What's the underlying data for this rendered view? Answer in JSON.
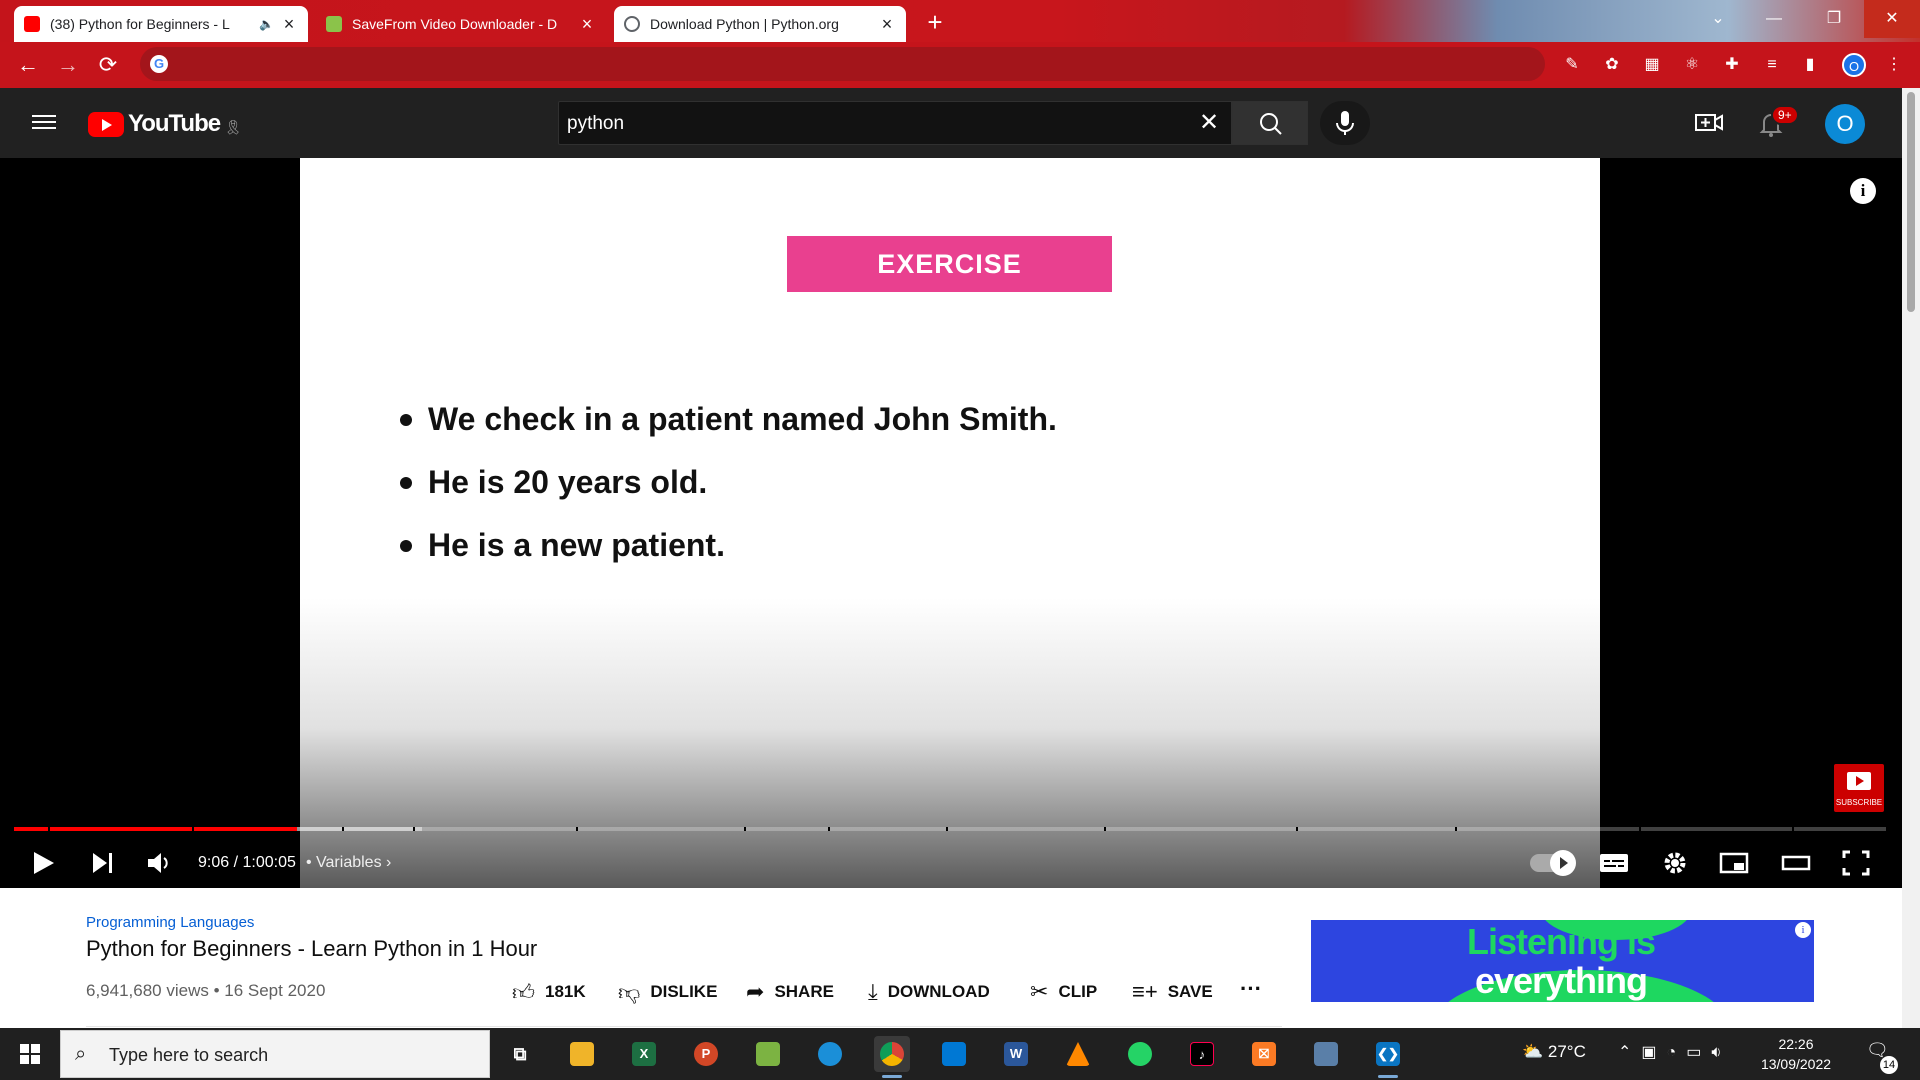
{
  "browser": {
    "tabs": [
      {
        "title": "(38) Python for Beginners - L",
        "active": true
      },
      {
        "title": "SaveFrom Video Downloader - D",
        "active": false
      },
      {
        "title": "Download Python | Python.org",
        "active": false
      }
    ],
    "new_tab": "+",
    "window_controls": {
      "more": "⌄",
      "minimize": "—",
      "restore": "❐",
      "close": "✕"
    },
    "nav": {
      "back": "←",
      "forward": "→",
      "reload": "⟳"
    },
    "omnibox_icon": "G",
    "profile_initial": "O"
  },
  "youtube": {
    "logo_text": "YouTube",
    "search": {
      "value": "python",
      "clear": "✕"
    },
    "notifications_badge": "9+",
    "avatar_initial": "O"
  },
  "player": {
    "slide": {
      "banner": "EXERCISE",
      "bullets": [
        "We check in a patient named John Smith.",
        "He is 20 years old.",
        "He is a new patient."
      ]
    },
    "info_icon": "i",
    "subscribe_watermark": "SUBSCRIBE",
    "time": "9:06 / 1:00:05",
    "chapter": "• Variables ›",
    "progress_played_fraction": 0.151,
    "progress_loaded_fraction": 0.218,
    "chapter_marks_fraction": [
      0.018,
      0.095,
      0.175,
      0.213,
      0.3,
      0.39,
      0.435,
      0.498,
      0.582,
      0.685,
      0.77,
      0.868,
      0.95
    ]
  },
  "video": {
    "category": "Programming Languages",
    "title": "Python for Beginners - Learn Python in 1 Hour",
    "views": "6,941,680 views • 16 Sept 2020",
    "actions": {
      "like": "181K",
      "dislike": "DISLIKE",
      "share": "SHARE",
      "download": "DOWNLOAD",
      "clip": "CLIP",
      "save": "SAVE"
    },
    "more": "···"
  },
  "ad": {
    "line1": "Listening is",
    "line2": "everything"
  },
  "taskbar": {
    "search_placeholder": "Type here to search",
    "weather": "27°C",
    "time": "22:26",
    "date": "13/09/2022",
    "notification_count": "14"
  },
  "colors": {
    "chrome_theme": "#c5141b",
    "yt_red": "#ff0000",
    "banner_pink": "#e9408f",
    "link_blue": "#065fd4",
    "ad_blue": "#2d45e0",
    "ad_green": "#1ed760"
  }
}
